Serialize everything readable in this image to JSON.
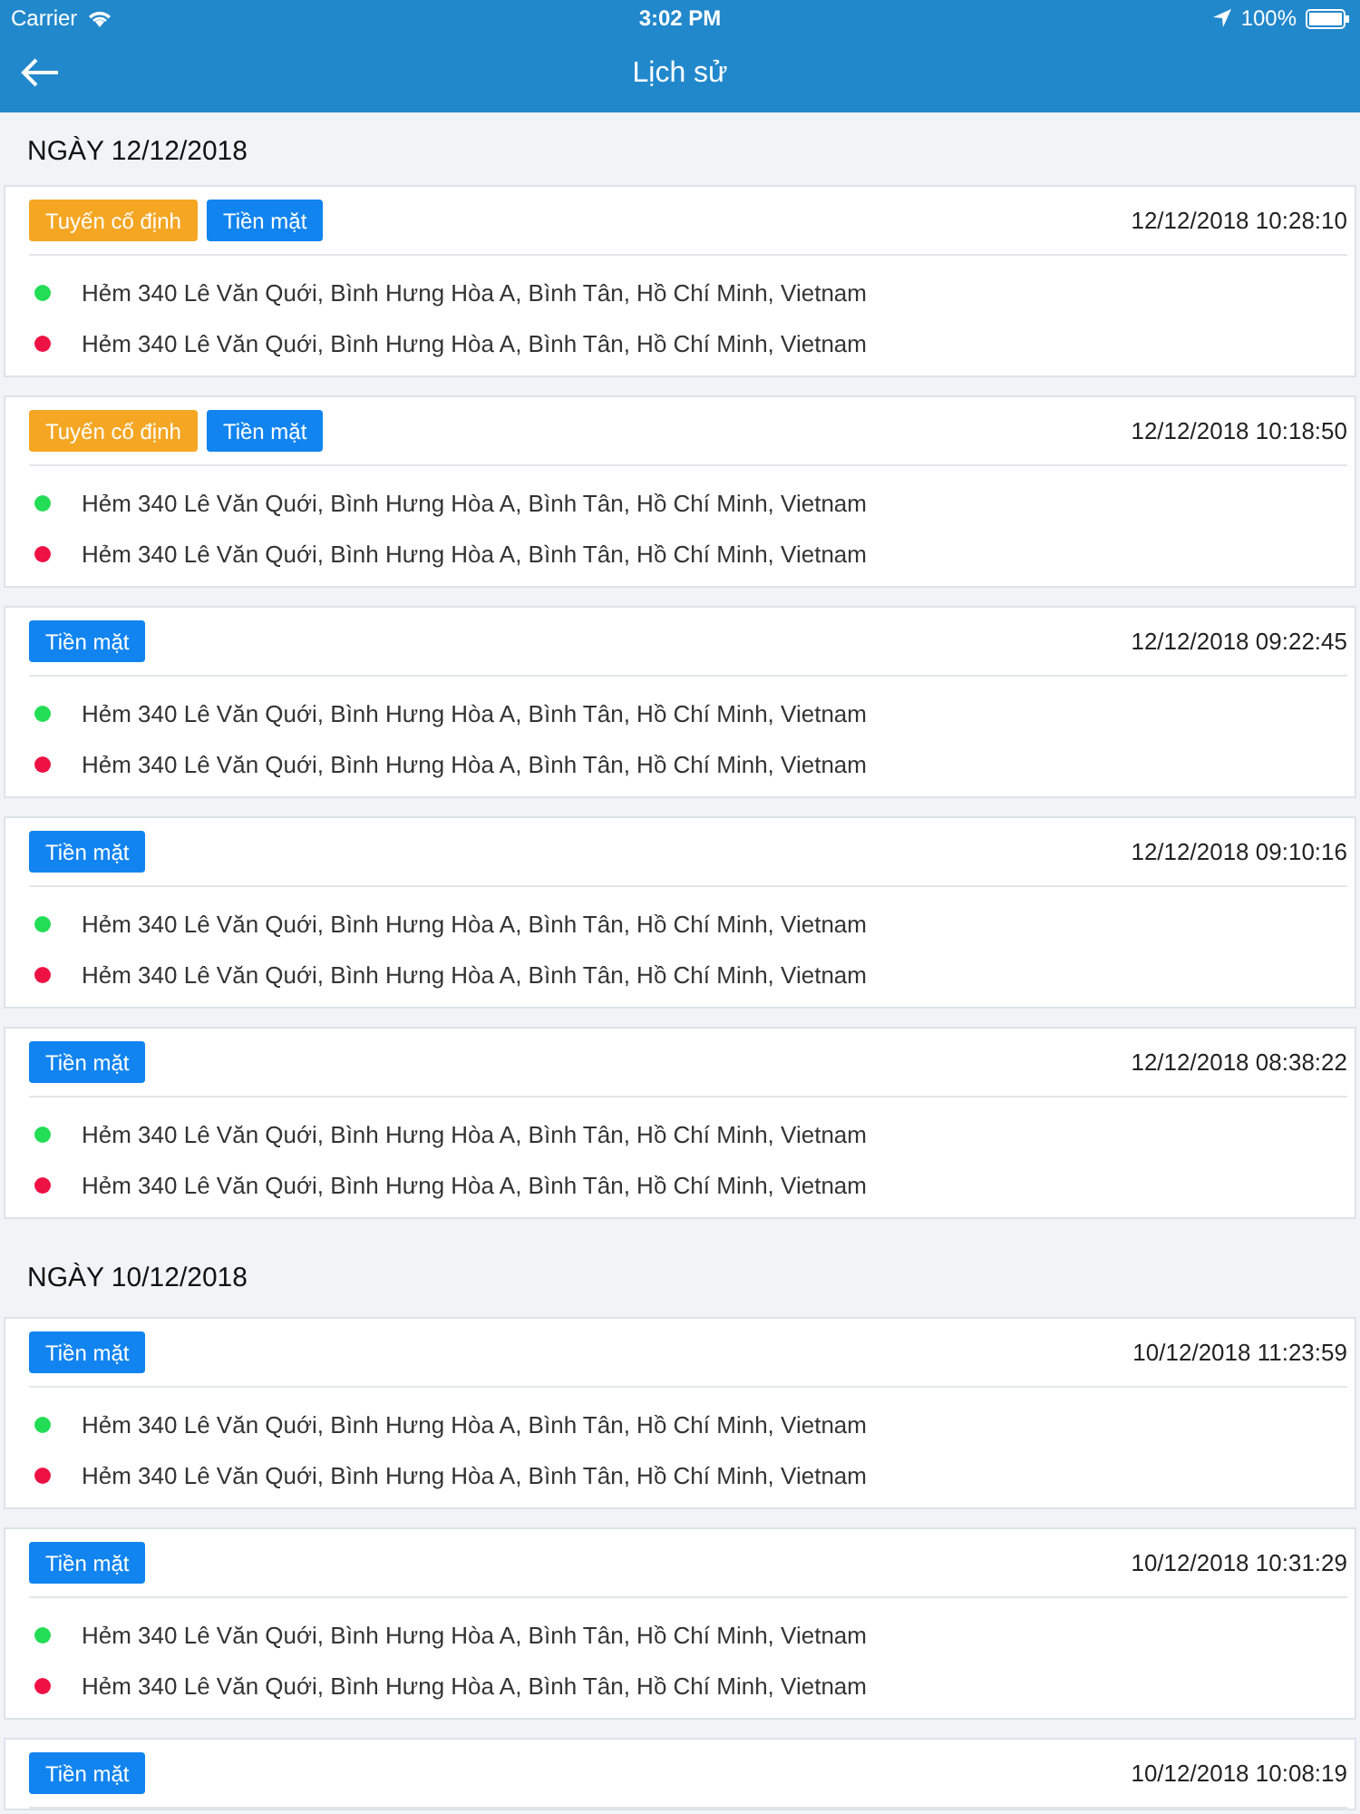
{
  "status_bar": {
    "carrier": "Carrier",
    "time": "3:02 PM",
    "battery": "100%"
  },
  "nav": {
    "title": "Lịch sử"
  },
  "sections": [
    {
      "date": "NGÀY 12/12/2018",
      "trips": [
        {
          "tags": [
            {
              "kind": "fixed_route",
              "label": "Tuyến cố định"
            },
            {
              "kind": "cash",
              "label": "Tiền mặt"
            }
          ],
          "time": "12/12/2018 10:28:10",
          "stops": [
            {
              "color": "#22dd55",
              "address": "Hẻm 340 Lê Văn Quới, Bình Hưng Hòa A, Bình Tân, Hồ Chí Minh, Vietnam"
            },
            {
              "color": "#ee1144",
              "address": "Hẻm 340 Lê Văn Quới, Bình Hưng Hòa A, Bình Tân, Hồ Chí Minh, Vietnam"
            }
          ]
        },
        {
          "tags": [
            {
              "kind": "fixed_route",
              "label": "Tuyến cố định"
            },
            {
              "kind": "cash",
              "label": "Tiền mặt"
            }
          ],
          "time": "12/12/2018 10:18:50",
          "stops": [
            {
              "color": "#22dd55",
              "address": "Hẻm 340 Lê Văn Quới, Bình Hưng Hòa A, Bình Tân, Hồ Chí Minh, Vietnam"
            },
            {
              "color": "#ee1144",
              "address": "Hẻm 340 Lê Văn Quới, Bình Hưng Hòa A, Bình Tân, Hồ Chí Minh, Vietnam"
            }
          ]
        },
        {
          "tags": [
            {
              "kind": "cash",
              "label": "Tiền mặt"
            }
          ],
          "time": "12/12/2018 09:22:45",
          "stops": [
            {
              "color": "#22dd55",
              "address": "Hẻm 340 Lê Văn Quới, Bình Hưng Hòa A, Bình Tân, Hồ Chí Minh, Vietnam"
            },
            {
              "color": "#ee1144",
              "address": "Hẻm 340 Lê Văn Quới, Bình Hưng Hòa A, Bình Tân, Hồ Chí Minh, Vietnam"
            }
          ]
        },
        {
          "tags": [
            {
              "kind": "cash",
              "label": "Tiền mặt"
            }
          ],
          "time": "12/12/2018 09:10:16",
          "stops": [
            {
              "color": "#22dd55",
              "address": "Hẻm 340 Lê Văn Quới, Bình Hưng Hòa A, Bình Tân, Hồ Chí Minh, Vietnam"
            },
            {
              "color": "#ee1144",
              "address": "Hẻm 340 Lê Văn Quới, Bình Hưng Hòa A, Bình Tân, Hồ Chí Minh, Vietnam"
            }
          ]
        },
        {
          "tags": [
            {
              "kind": "cash",
              "label": "Tiền mặt"
            }
          ],
          "time": "12/12/2018 08:38:22",
          "stops": [
            {
              "color": "#22dd55",
              "address": "Hẻm 340 Lê Văn Quới, Bình Hưng Hòa A, Bình Tân, Hồ Chí Minh, Vietnam"
            },
            {
              "color": "#ee1144",
              "address": "Hẻm 340 Lê Văn Quới, Bình Hưng Hòa A, Bình Tân, Hồ Chí Minh, Vietnam"
            }
          ]
        }
      ]
    },
    {
      "date": "NGÀY 10/12/2018",
      "trips": [
        {
          "tags": [
            {
              "kind": "cash",
              "label": "Tiền mặt"
            }
          ],
          "time": "10/12/2018 11:23:59",
          "stops": [
            {
              "color": "#22dd55",
              "address": "Hẻm 340 Lê Văn Quới, Bình Hưng Hòa A, Bình Tân, Hồ Chí Minh, Vietnam"
            },
            {
              "color": "#ee1144",
              "address": "Hẻm 340 Lê Văn Quới, Bình Hưng Hòa A, Bình Tân, Hồ Chí Minh, Vietnam"
            }
          ]
        },
        {
          "tags": [
            {
              "kind": "cash",
              "label": "Tiền mặt"
            }
          ],
          "time": "10/12/2018 10:31:29",
          "stops": [
            {
              "color": "#22dd55",
              "address": "Hẻm 340 Lê Văn Quới, Bình Hưng Hòa A, Bình Tân, Hồ Chí Minh, Vietnam"
            },
            {
              "color": "#ee1144",
              "address": "Hẻm 340 Lê Văn Quới, Bình Hưng Hòa A, Bình Tân, Hồ Chí Minh, Vietnam"
            }
          ]
        },
        {
          "tags": [
            {
              "kind": "cash",
              "label": "Tiền mặt"
            }
          ],
          "time": "10/12/2018 10:08:19"
        }
      ]
    }
  ]
}
